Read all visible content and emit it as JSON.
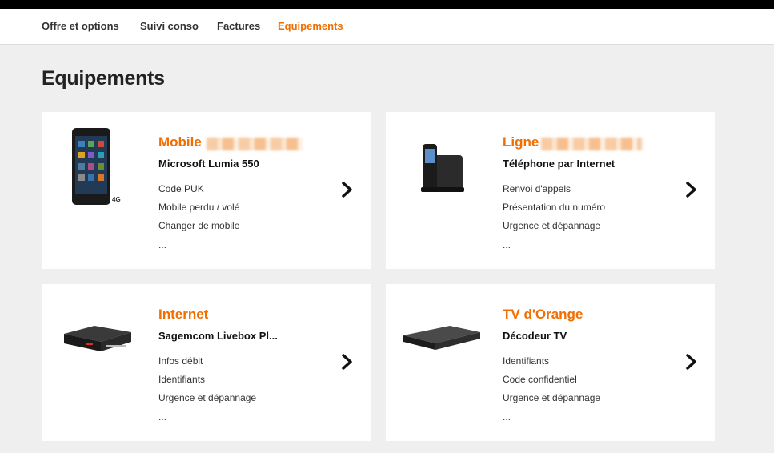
{
  "nav": {
    "tabs": [
      {
        "label": "Offre et options"
      },
      {
        "label": "Suivi conso"
      },
      {
        "label": "Factures"
      },
      {
        "label": "Equipements"
      }
    ],
    "active_color": "#f16e00"
  },
  "page": {
    "title": "Equipements"
  },
  "cards": [
    {
      "title": "Mobile",
      "subtitle": "Microsoft Lumia 550",
      "device_badge": "4G",
      "links": [
        "Code PUK",
        "Mobile perdu / volé",
        "Changer de mobile",
        "..."
      ],
      "icon": "smartphone-image"
    },
    {
      "title": "Ligne",
      "subtitle": "Téléphone par Internet",
      "links": [
        "Renvoi d'appels",
        "Présentation du numéro",
        "Urgence et dépannage",
        "..."
      ],
      "icon": "cordless-phone-image"
    },
    {
      "title": "Internet",
      "subtitle": "Sagemcom Livebox Pl...",
      "links": [
        "Infos débit",
        "Identifiants",
        "Urgence et dépannage",
        "..."
      ],
      "icon": "livebox-router-image"
    },
    {
      "title": "TV d'Orange",
      "subtitle": "Décodeur TV",
      "links": [
        "Identifiants",
        "Code confidentiel",
        "Urgence et dépannage",
        "..."
      ],
      "icon": "tv-decoder-image"
    }
  ],
  "colors": {
    "accent": "#f16e00",
    "background": "#efefef",
    "card": "#ffffff"
  }
}
